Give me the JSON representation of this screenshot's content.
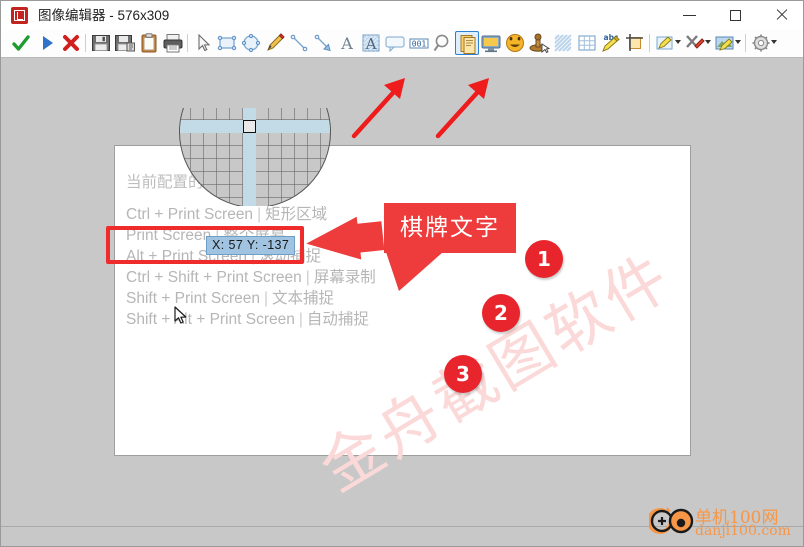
{
  "window": {
    "title": "图像编辑器 - 576x309",
    "icon": "app-icon",
    "minimize_label": "—",
    "maximize_label": "□",
    "close_label": "✕"
  },
  "toolbar": {
    "items": [
      {
        "name": "confirm-check-icon",
        "label": "确认"
      },
      {
        "name": "play-icon",
        "label": "播放"
      },
      {
        "name": "cancel-cross-icon",
        "label": "取消"
      },
      {
        "name": "save-icon",
        "label": "保存"
      },
      {
        "name": "save-as-icon",
        "label": "另存为"
      },
      {
        "name": "clipboard-icon",
        "label": "复制到剪贴板"
      },
      {
        "name": "print-icon",
        "label": "打印"
      },
      {
        "name": "pointer-icon",
        "label": "选择"
      },
      {
        "name": "rectangle-icon",
        "label": "矩形"
      },
      {
        "name": "ellipse-icon",
        "label": "椭圆"
      },
      {
        "name": "pencil-icon",
        "label": "画笔"
      },
      {
        "name": "line-icon",
        "label": "直线"
      },
      {
        "name": "arrow-icon",
        "label": "箭头"
      },
      {
        "name": "text-icon",
        "label": "文字"
      },
      {
        "name": "text-box-icon",
        "label": "文本框"
      },
      {
        "name": "callout-icon",
        "label": "气泡标注"
      },
      {
        "name": "number-001-icon",
        "label": "序号标注"
      },
      {
        "name": "magnifier-icon",
        "label": "放大镜"
      },
      {
        "name": "page-icon",
        "label": "棋牌文字"
      },
      {
        "name": "monitor-icon",
        "label": "屏幕"
      },
      {
        "name": "smiley-icon",
        "label": "表情"
      },
      {
        "name": "stamp-icon",
        "label": "图章"
      },
      {
        "name": "mosaic-icon",
        "label": "马赛克"
      },
      {
        "name": "grid-icon",
        "label": "网格"
      },
      {
        "name": "abc-highlight-icon",
        "label": "荧光笔"
      },
      {
        "name": "crop-icon",
        "label": "裁剪"
      },
      {
        "name": "edit-dropdown-icon",
        "label": "编辑"
      },
      {
        "name": "tools-dropdown-icon",
        "label": "工具"
      },
      {
        "name": "image-dropdown-icon",
        "label": "图像"
      },
      {
        "name": "settings-dropdown-icon",
        "label": "设置"
      }
    ],
    "selected_index": 18
  },
  "canvas": {
    "shortcuts_title": "当前配置的快捷键",
    "separator": "|",
    "shortcuts": [
      {
        "keys": "Ctrl + Print Screen",
        "action": "矩形区域"
      },
      {
        "keys": "Print Screen",
        "action": "整个屏幕"
      },
      {
        "keys": "Alt + Print Screen",
        "action": "滚动捕捉"
      },
      {
        "keys": "Ctrl + Shift + Print Screen",
        "action": "屏幕录制"
      },
      {
        "keys": "Shift + Print Screen",
        "action": "文本捕捉"
      },
      {
        "keys": "Shift + Alt + Print Screen",
        "action": "自动捕捉"
      }
    ],
    "watermark": "金舟截图软件"
  },
  "annotations": {
    "tooltip": "X: 57 Y: -137",
    "callout_text": "棋牌文字",
    "badges": [
      "1",
      "2",
      "3"
    ],
    "red_color": "#ee3b3b",
    "highlight_color": "#9fc3e0"
  },
  "statusbar": {
    "text": ""
  },
  "logo": {
    "line1": "单机100网",
    "line2": "danji100.com",
    "color": "#f79646"
  }
}
